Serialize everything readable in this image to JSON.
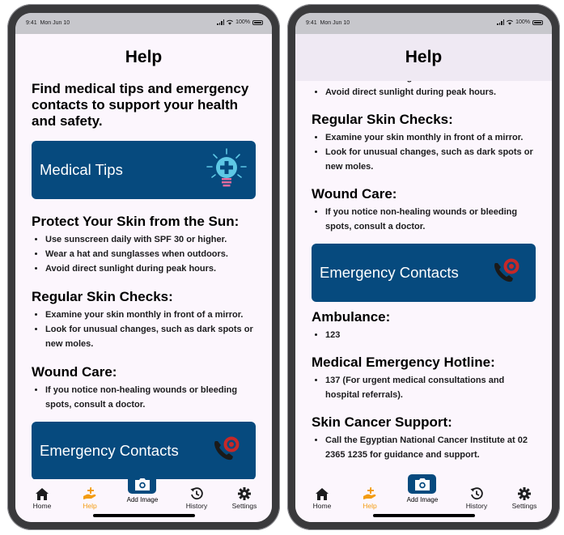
{
  "status": {
    "time": "9:41",
    "date": "Mon Jun 10",
    "battery": "100%"
  },
  "page": {
    "title": "Help"
  },
  "intro": "Find medical tips and emergency contacts to support your health and safety.",
  "medical_tips": {
    "banner_title": "Medical Tips",
    "icon": "lightbulb-medical-icon",
    "sections": [
      {
        "title": "Protect Your Skin from the Sun:",
        "items": [
          "Use sunscreen daily with SPF 30 or higher.",
          "Wear a hat and sunglasses when outdoors.",
          "Avoid direct sunlight during peak hours."
        ]
      },
      {
        "title": "Regular Skin Checks:",
        "items": [
          "Examine your skin monthly in front of a mirror.",
          "Look for unusual changes, such as dark spots or new moles."
        ]
      },
      {
        "title": "Wound Care:",
        "items": [
          "If you notice non-healing wounds or bleeding spots, consult a doctor."
        ]
      }
    ]
  },
  "emergency": {
    "banner_title": "Emergency Contacts",
    "icon": "phone-emergency-icon",
    "contacts": [
      {
        "title": "Ambulance:",
        "items": [
          "123"
        ]
      },
      {
        "title": "Medical Emergency Hotline:",
        "items": [
          "137 (For urgent medical consultations and hospital referrals)."
        ]
      },
      {
        "title": "Skin Cancer Support:",
        "items": [
          "Call the Egyptian National Cancer Institute at 02 2365 1235 for guidance and support."
        ]
      }
    ]
  },
  "tabs": [
    {
      "label": "Home",
      "icon": "home-icon"
    },
    {
      "label": "Help",
      "icon": "help-hand-icon",
      "active": true
    },
    {
      "label": "Add Image",
      "icon": "camera-icon"
    },
    {
      "label": "History",
      "icon": "history-icon"
    },
    {
      "label": "Settings",
      "icon": "gear-icon"
    }
  ],
  "colors": {
    "banner": "#064a7e",
    "active_tab": "#f39c12",
    "background": "#fcf6fd",
    "emergency_accent": "#c62828"
  }
}
